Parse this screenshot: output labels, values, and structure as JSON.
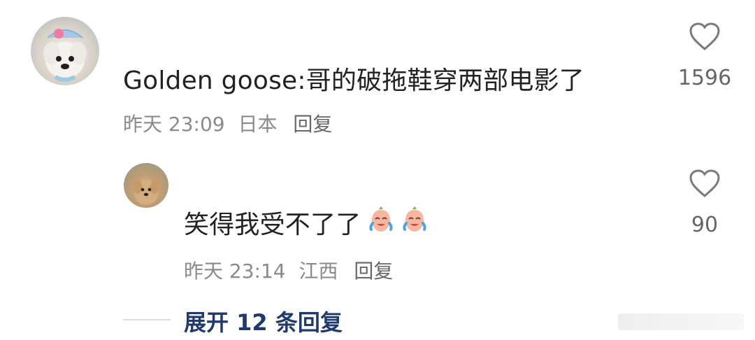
{
  "comment": {
    "author": "Golden goose",
    "text": "Golden goose:哥的破拖鞋穿两部电影了",
    "meta": {
      "time": "昨天 23:09",
      "location": "日本",
      "reply_label": "回复"
    },
    "likes": "1596"
  },
  "reply": {
    "text": "笑得我受不了了",
    "meta": {
      "time": "昨天 23:14",
      "location": "江西",
      "reply_label": "回复"
    },
    "likes": "90",
    "emoji_names": [
      "crying-laughing-emoji",
      "crying-laughing-emoji"
    ]
  },
  "expand_replies": "展开 12 条回复",
  "colors": {
    "expand_link": "#223a6b",
    "meta_text": "#8a8a8a",
    "icon_stroke": "#7a7a7a"
  },
  "icons": {
    "like": "heart-outline-icon"
  }
}
